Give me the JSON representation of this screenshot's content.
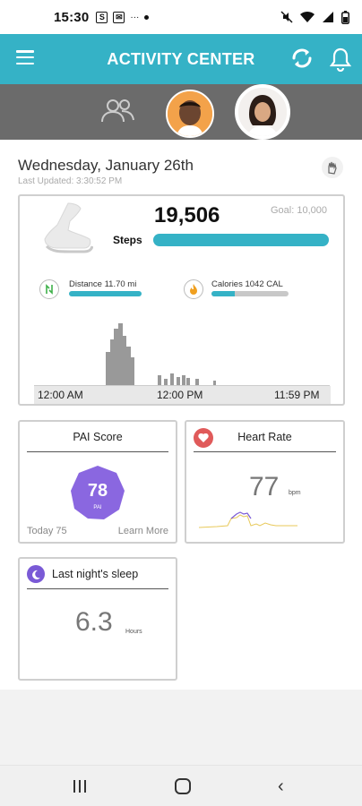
{
  "status_bar": {
    "time": "15:30"
  },
  "header": {
    "title": "ACTIVITY CENTER",
    "brand_color": "#35b2c6"
  },
  "activity": {
    "date": "Wednesday, January 26th",
    "last_updated": "Last Updated: 3:30:52 PM",
    "steps": {
      "value": "19,506",
      "label": "Steps",
      "goal": "Goal: 10,000",
      "progress_fraction": 1.0
    },
    "distance": {
      "label": "Distance 11.70 mi",
      "progress_fraction": 1.0
    },
    "calories": {
      "label": "Calories 1042 CAL",
      "progress_fraction": 0.3
    },
    "time_axis": [
      "12:00 AM",
      "12:00 PM",
      "11:59 PM"
    ]
  },
  "pai": {
    "title": "PAI Score",
    "value": "78",
    "unit": "PAI",
    "today": "Today 75",
    "learn_more": "Learn More",
    "color": "#8a67e0"
  },
  "heart_rate": {
    "title": "Heart Rate",
    "value": "77",
    "unit": "bpm"
  },
  "sleep": {
    "title": "Last night's sleep",
    "value": "6.3",
    "unit": "Hours"
  }
}
